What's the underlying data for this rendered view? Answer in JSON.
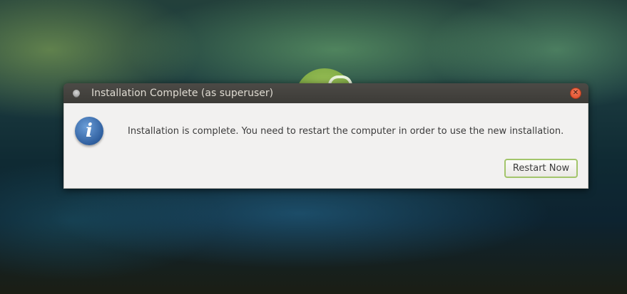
{
  "desktop": {
    "background_name": "starry-green-blue-aurora-wallpaper",
    "logo_icon": "ubuntu-mate-logo-icon"
  },
  "dialog": {
    "title": "Installation Complete (as superuser)",
    "app_icon": "installer-app-icon",
    "close_icon": "close-icon",
    "info_icon": "info-icon",
    "info_glyph": "i",
    "message": "Installation is complete. You need to restart the computer in order to use the new installation.",
    "restart_label": "Restart Now",
    "colors": {
      "titlebar": "#3c3b37",
      "close": "#df4a26",
      "button_focus": "#a3c56b"
    }
  }
}
